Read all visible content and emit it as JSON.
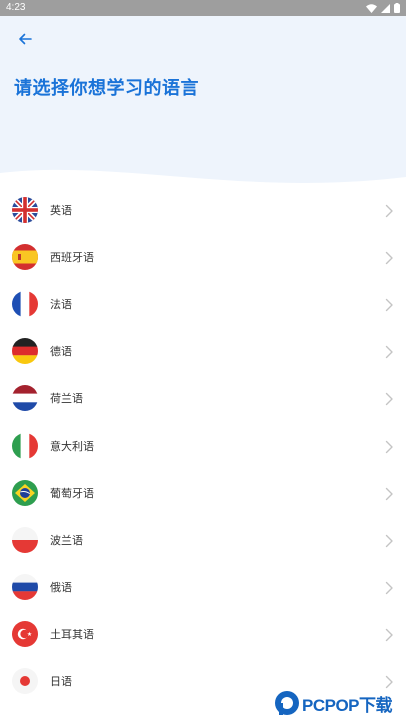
{
  "status_bar": {
    "time": "4:23",
    "icons": [
      "wifi-icon",
      "signal-icon",
      "battery-icon"
    ]
  },
  "header": {
    "title": "请选择你想学习的语言",
    "back_icon": "arrow-left-icon",
    "accent_color": "#1a73d8",
    "background_color": "#eef4fc"
  },
  "languages": [
    {
      "label": "英语",
      "flag": "uk"
    },
    {
      "label": "西班牙语",
      "flag": "spain"
    },
    {
      "label": "法语",
      "flag": "france"
    },
    {
      "label": "德语",
      "flag": "germany"
    },
    {
      "label": "荷兰语",
      "flag": "netherlands"
    },
    {
      "label": "意大利语",
      "flag": "italy"
    },
    {
      "label": "葡萄牙语",
      "flag": "brazil"
    },
    {
      "label": "波兰语",
      "flag": "poland"
    },
    {
      "label": "俄语",
      "flag": "russia"
    },
    {
      "label": "土耳其语",
      "flag": "turkey"
    },
    {
      "label": "日语",
      "flag": "japan"
    }
  ],
  "watermark": {
    "text": "PCPOP下载"
  }
}
